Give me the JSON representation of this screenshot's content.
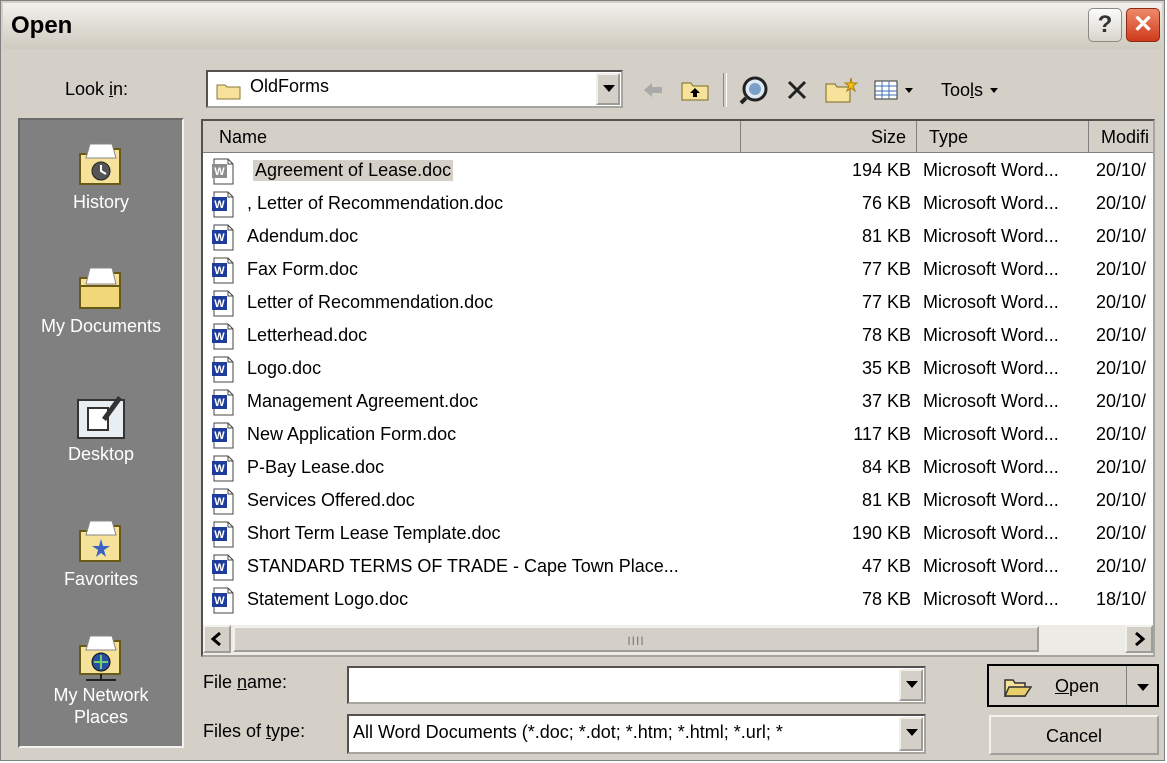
{
  "title": "Open",
  "look_in": {
    "label_pre": "Look ",
    "label_key": "i",
    "label_post": "n:",
    "value": "OldForms"
  },
  "toolbar": {
    "tools_pre": "Too",
    "tools_key": "l",
    "tools_post": "s"
  },
  "places": [
    {
      "label": "History"
    },
    {
      "label": "My Documents"
    },
    {
      "label": "Desktop"
    },
    {
      "label": "Favorites"
    },
    {
      "label": "My Network Places"
    }
  ],
  "columns": [
    "Name",
    "Size",
    "Type",
    "Modifi"
  ],
  "files": [
    {
      "name": "Agreement of Lease.doc",
      "size": "194 KB",
      "type": "Microsoft Word...",
      "modified": "20/10/"
    },
    {
      "name": ", Letter of Recommendation.doc",
      "size": "76 KB",
      "type": "Microsoft Word...",
      "modified": "20/10/"
    },
    {
      "name": "Adendum.doc",
      "size": "81 KB",
      "type": "Microsoft Word...",
      "modified": "20/10/"
    },
    {
      "name": "Fax Form.doc",
      "size": "77 KB",
      "type": "Microsoft Word...",
      "modified": "20/10/"
    },
    {
      "name": "Letter of Recommendation.doc",
      "size": "77 KB",
      "type": "Microsoft Word...",
      "modified": "20/10/"
    },
    {
      "name": "Letterhead.doc",
      "size": "78 KB",
      "type": "Microsoft Word...",
      "modified": "20/10/"
    },
    {
      "name": "Logo.doc",
      "size": "35 KB",
      "type": "Microsoft Word...",
      "modified": "20/10/"
    },
    {
      "name": "Management Agreement.doc",
      "size": "37 KB",
      "type": "Microsoft Word...",
      "modified": "20/10/"
    },
    {
      "name": "New Application Form.doc",
      "size": "117 KB",
      "type": "Microsoft Word...",
      "modified": "20/10/"
    },
    {
      "name": "P-Bay Lease.doc",
      "size": "84 KB",
      "type": "Microsoft Word...",
      "modified": "20/10/"
    },
    {
      "name": "Services Offered.doc",
      "size": "81 KB",
      "type": "Microsoft Word...",
      "modified": "20/10/"
    },
    {
      "name": "Short Term Lease Template.doc",
      "size": "190 KB",
      "type": "Microsoft Word...",
      "modified": "20/10/"
    },
    {
      "name": "STANDARD TERMS OF TRADE - Cape Town Place...",
      "size": "47 KB",
      "type": "Microsoft Word...",
      "modified": "20/10/"
    },
    {
      "name": "Statement Logo.doc",
      "size": "78 KB",
      "type": "Microsoft Word...",
      "modified": "18/10/"
    }
  ],
  "file_name": {
    "label_pre": "File ",
    "label_key": "n",
    "label_post": "ame:",
    "value": ""
  },
  "file_type": {
    "label_pre": "Files of ",
    "label_key": "t",
    "label_post": "ype:",
    "value": "All Word Documents (*.doc; *.dot; *.htm; *.html; *.url; *"
  },
  "buttons": {
    "open_key": "O",
    "open_rest": "pen",
    "cancel": "Cancel"
  },
  "scroll_grip": "IIII"
}
